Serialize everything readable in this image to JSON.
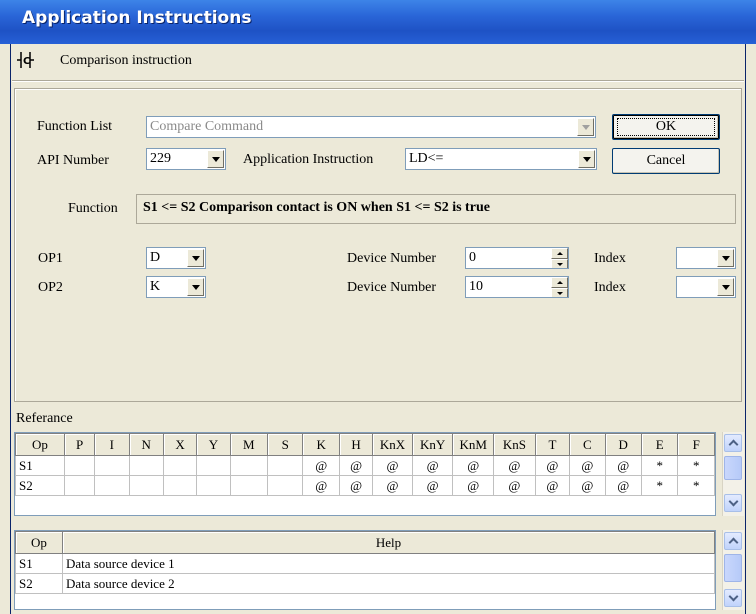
{
  "window": {
    "title": "Application Instructions",
    "subtitle": "Comparison instruction",
    "icon": "contact-icon"
  },
  "form": {
    "function_list_label": "Function List",
    "function_list_value": "Compare Command",
    "api_number_label": "API Number",
    "api_number_value": "229",
    "app_instruction_label": "Application Instruction",
    "app_instruction_value": "LD<=",
    "function_label": "Function",
    "function_text": "S1 <= S2 Comparison contact is ON when S1 <= S2 is true",
    "ok_label": "OK",
    "cancel_label": "Cancel",
    "op1_label": "OP1",
    "op1_value": "D",
    "op2_label": "OP2",
    "op2_value": "K",
    "device_number_label": "Device Number",
    "device_number_1": "0",
    "device_number_2": "10",
    "index_label": "Index",
    "index_1": "",
    "index_2": ""
  },
  "reference": {
    "title": "Referance",
    "columns": [
      "Op",
      "P",
      "I",
      "N",
      "X",
      "Y",
      "M",
      "S",
      "K",
      "H",
      "KnX",
      "KnY",
      "KnM",
      "KnS",
      "T",
      "C",
      "D",
      "E",
      "F"
    ],
    "rows": [
      [
        "S1",
        "",
        "",
        "",
        "",
        "",
        "",
        "",
        "@",
        "@",
        "@",
        "@",
        "@",
        "@",
        "@",
        "@",
        "@",
        "*",
        "*"
      ],
      [
        "S2",
        "",
        "",
        "",
        "",
        "",
        "",
        "",
        "@",
        "@",
        "@",
        "@",
        "@",
        "@",
        "@",
        "@",
        "@",
        "*",
        "*"
      ]
    ]
  },
  "help": {
    "columns": [
      "Op",
      "Help"
    ],
    "rows": [
      [
        "S1",
        "Data source device 1"
      ],
      [
        "S2",
        "Data source device 2"
      ]
    ]
  },
  "colors": {
    "title_bar": "#2660d6",
    "window_bg": "#ece9d8",
    "field_border": "#7f9db9"
  }
}
